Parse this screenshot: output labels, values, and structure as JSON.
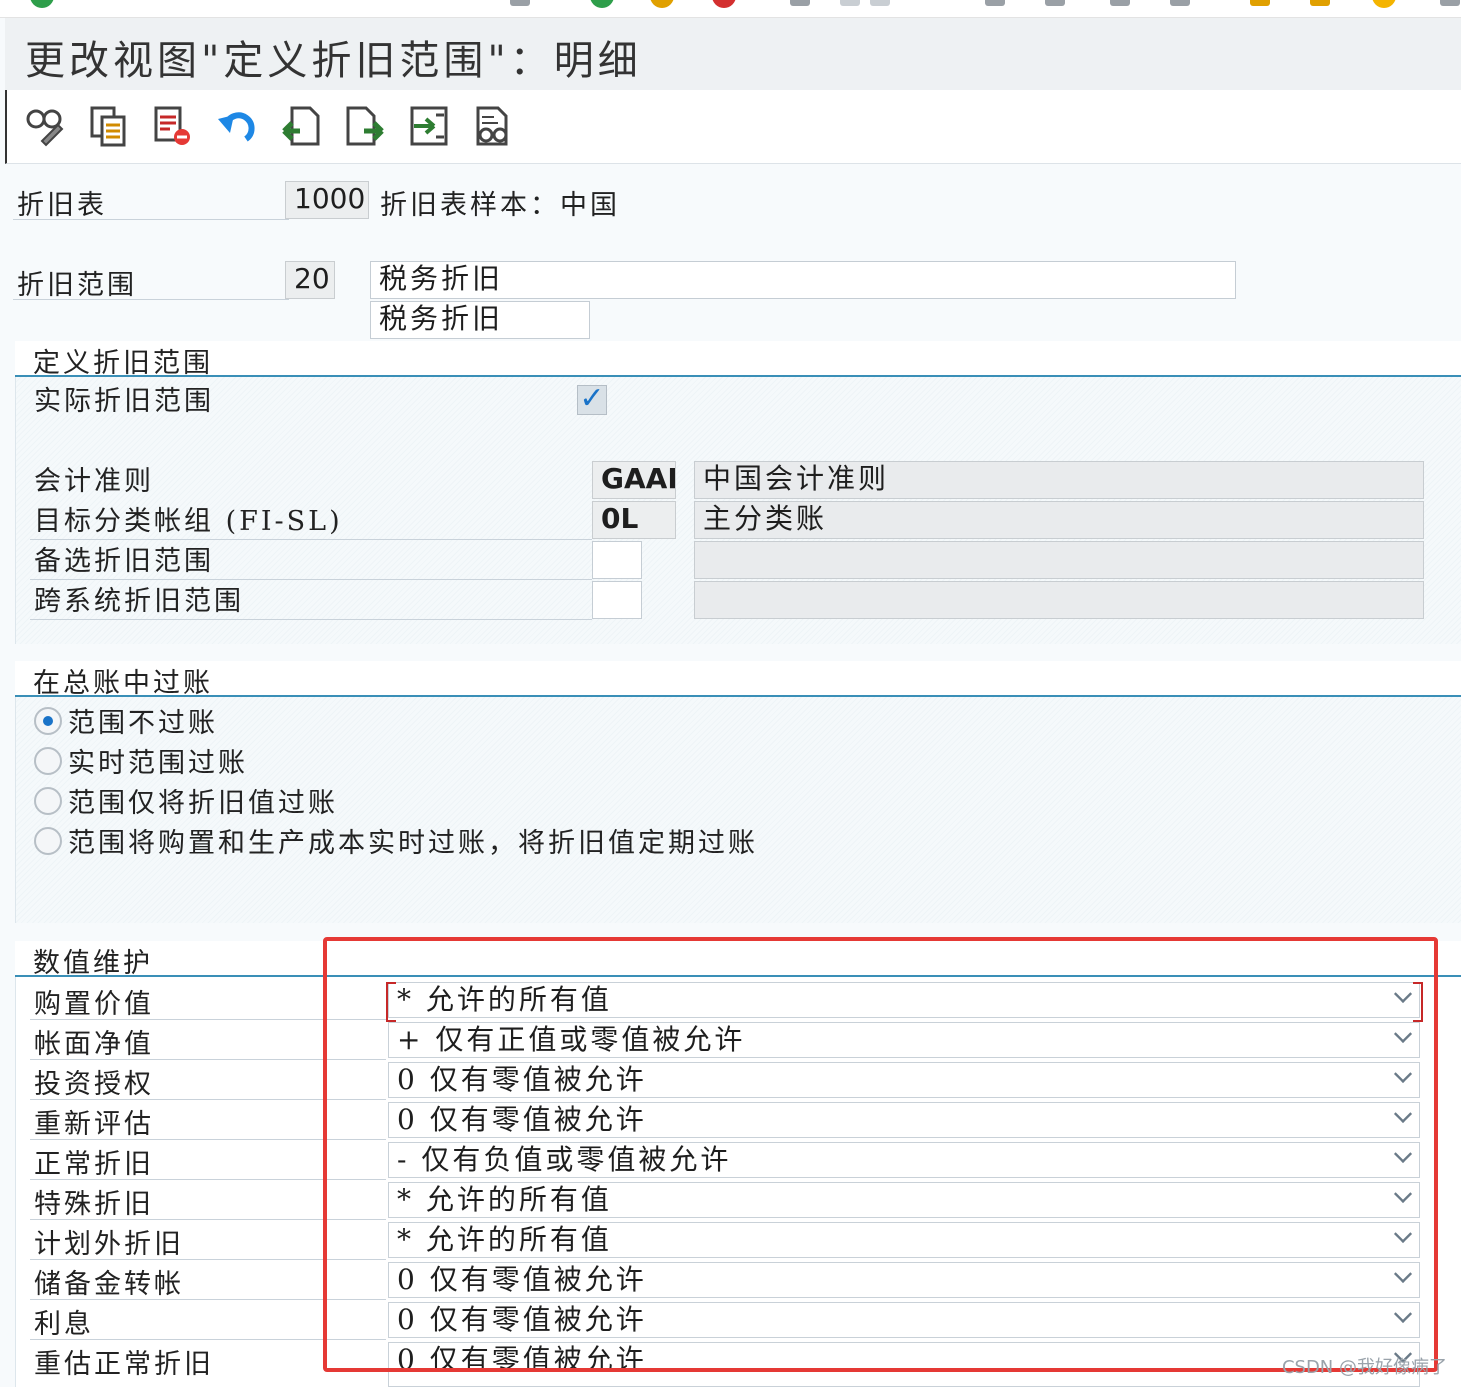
{
  "window": {
    "title": "更改视图\"定义折旧范围\"：明细"
  },
  "toolbar": {
    "buttons": [
      {
        "icon": "display-change-icon"
      },
      {
        "icon": "copy-icon"
      },
      {
        "icon": "delete-icon"
      },
      {
        "icon": "undo-icon"
      },
      {
        "icon": "previous-entry-icon"
      },
      {
        "icon": "next-entry-icon"
      },
      {
        "icon": "select-all-icon"
      },
      {
        "icon": "print-icon"
      }
    ]
  },
  "header": {
    "chart_label": "折旧表",
    "chart_value": "1000",
    "chart_desc": "折旧表样本：中国",
    "area_label": "折旧范围",
    "area_value": "20",
    "area_desc_long": "税务折旧",
    "area_desc_short": "税务折旧"
  },
  "define_area": {
    "title": "定义折旧范围",
    "real_area_label": "实际折旧范围",
    "real_area_checked": true,
    "gaap_label": "会计准则",
    "gaap_value": "GAAP",
    "gaap_desc": "中国会计准则",
    "ledger_label": "目标分类帐组 (FI-SL)",
    "ledger_value": "0L",
    "ledger_desc": "主分类账",
    "alt_area_label": "备选折旧范围",
    "alt_area_value": "",
    "alt_area_desc": "",
    "cross_area_label": "跨系统折旧范围",
    "cross_area_value": "",
    "cross_area_desc": ""
  },
  "gl_posting": {
    "title": "在总账中过账",
    "options": [
      {
        "label": "范围不过账",
        "selected": true
      },
      {
        "label": "实时范围过账",
        "selected": false
      },
      {
        "label": "范围仅将折旧值过账",
        "selected": false
      },
      {
        "label": "范围将购置和生产成本实时过账，将折旧值定期过账",
        "selected": false
      }
    ]
  },
  "value_maintenance": {
    "title": "数值维护",
    "rows": [
      {
        "label": "购置价值",
        "value": "*  允许的所有值"
      },
      {
        "label": "帐面净值",
        "value": "+  仅有正值或零值被允许"
      },
      {
        "label": "投资授权",
        "value": "0  仅有零值被允许"
      },
      {
        "label": "重新评估",
        "value": "0  仅有零值被允许"
      },
      {
        "label": "正常折旧",
        "value": "-  仅有负值或零值被允许"
      },
      {
        "label": "特殊折旧",
        "value": "*  允许的所有值"
      },
      {
        "label": "计划外折旧",
        "value": "*  允许的所有值"
      },
      {
        "label": "储备金转帐",
        "value": "0  仅有零值被允许"
      },
      {
        "label": "利息",
        "value": "0  仅有零值被允许"
      },
      {
        "label": "重估正常折旧",
        "value": "0  仅有零值被允许"
      }
    ]
  },
  "watermark": "CSDN @我好像病了"
}
